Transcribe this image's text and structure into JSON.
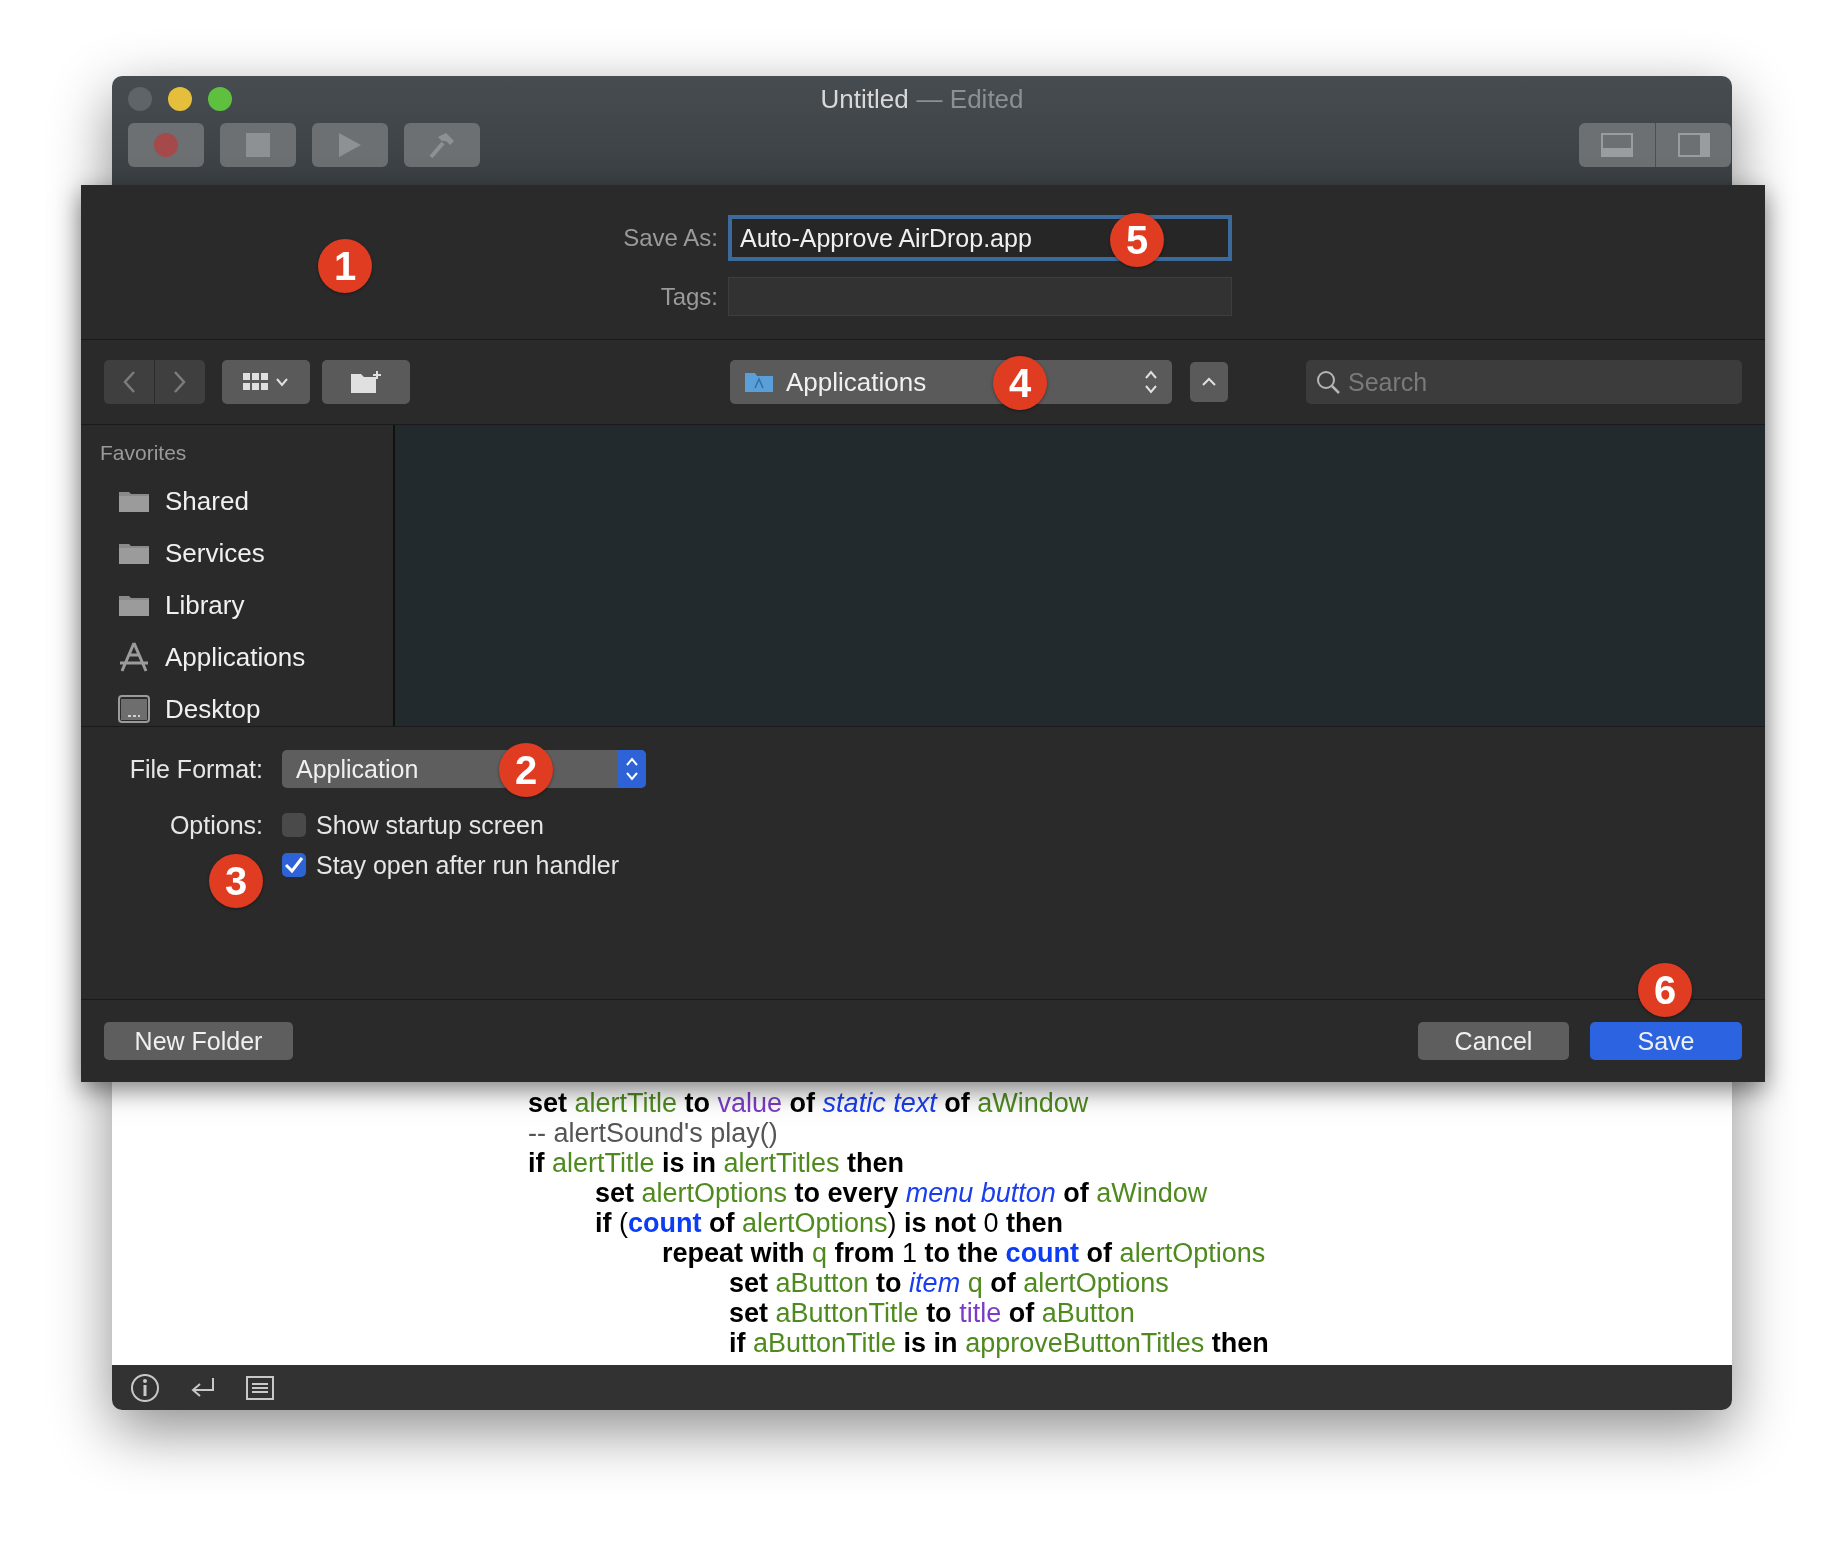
{
  "window": {
    "title": "Untitled",
    "subtitle": "— Edited"
  },
  "save_dialog": {
    "callout": "1",
    "save_as": {
      "label": "Save As:",
      "value": "Auto-Approve AirDrop.app",
      "focused": true,
      "callout": "5"
    },
    "tags": {
      "label": "Tags:"
    },
    "location": {
      "value": "Applications",
      "callout": "4"
    },
    "search": {
      "placeholder": "Search"
    },
    "sidebar": {
      "heading": "Favorites",
      "items": [
        {
          "label": "Shared",
          "kind": "folder"
        },
        {
          "label": "Services",
          "kind": "folder"
        },
        {
          "label": "Library",
          "kind": "folder"
        },
        {
          "label": "Applications",
          "kind": "apps"
        },
        {
          "label": "Desktop",
          "kind": "desktop"
        }
      ]
    },
    "file_format": {
      "label": "File Format:",
      "value": "Application",
      "callout": "2"
    },
    "options": {
      "label": "Options:",
      "callout": "3",
      "items": [
        {
          "label": "Show startup screen",
          "checked": false
        },
        {
          "label": "Stay open after run handler",
          "checked": true
        }
      ]
    },
    "buttons": [
      {
        "label": "New Folder",
        "kind": "plain"
      },
      {
        "label": "Cancel",
        "kind": "plain"
      },
      {
        "label": "Save",
        "kind": "default",
        "callout": "6"
      }
    ]
  },
  "code": [
    {
      "tokens": [
        {
          "kind": "kw",
          "text": "set "
        },
        {
          "kind": "var",
          "text": "alertTitle"
        },
        {
          "kind": "kw",
          "text": " to "
        },
        {
          "kind": "prop",
          "text": "value"
        },
        {
          "kind": "kw",
          "text": " of "
        },
        {
          "kind": "cls",
          "text": "static text"
        },
        {
          "kind": "kw",
          "text": " of "
        },
        {
          "kind": "var",
          "text": "aWindow"
        }
      ]
    },
    {
      "tokens": [
        {
          "kind": "comment",
          "text": "-- alertSound's play()"
        }
      ]
    },
    {
      "tokens": [
        {
          "kind": "kw",
          "text": "if "
        },
        {
          "kind": "var",
          "text": "alertTitle"
        },
        {
          "kind": "kw",
          "text": " is in "
        },
        {
          "kind": "var",
          "text": "alertTitles"
        },
        {
          "kind": "kw",
          "text": " then"
        }
      ],
      "children": [
        {
          "tokens": [
            {
              "kind": "kw",
              "text": "set "
            },
            {
              "kind": "var",
              "text": "alertOptions"
            },
            {
              "kind": "kw",
              "text": " to every "
            },
            {
              "kind": "cls",
              "text": "menu button"
            },
            {
              "kind": "kw",
              "text": " of "
            },
            {
              "kind": "var",
              "text": "aWindow"
            }
          ]
        },
        {
          "tokens": [
            {
              "kind": "kw",
              "text": "if "
            },
            {
              "kind": "plain",
              "text": "("
            },
            {
              "kind": "cmd",
              "text": "count"
            },
            {
              "kind": "kw",
              "text": " of "
            },
            {
              "kind": "var",
              "text": "alertOptions"
            },
            {
              "kind": "plain",
              "text": ")"
            },
            {
              "kind": "kw",
              "text": " is not "
            },
            {
              "kind": "plain",
              "text": "0"
            },
            {
              "kind": "kw",
              "text": " then"
            }
          ],
          "children": [
            {
              "tokens": [
                {
                  "kind": "kw",
                  "text": "repeat with "
                },
                {
                  "kind": "var",
                  "text": "q"
                },
                {
                  "kind": "kw",
                  "text": " from "
                },
                {
                  "kind": "plain",
                  "text": "1"
                },
                {
                  "kind": "kw",
                  "text": " to the "
                },
                {
                  "kind": "cmd",
                  "text": "count"
                },
                {
                  "kind": "kw",
                  "text": " of "
                },
                {
                  "kind": "var",
                  "text": "alertOptions"
                }
              ],
              "children": [
                {
                  "tokens": [
                    {
                      "kind": "kw",
                      "text": "set "
                    },
                    {
                      "kind": "var",
                      "text": "aButton"
                    },
                    {
                      "kind": "kw",
                      "text": " to "
                    },
                    {
                      "kind": "cls",
                      "text": "item"
                    },
                    {
                      "kind": "var",
                      "text": " q"
                    },
                    {
                      "kind": "kw",
                      "text": " of "
                    },
                    {
                      "kind": "var",
                      "text": "alertOptions"
                    }
                  ]
                },
                {
                  "tokens": [
                    {
                      "kind": "kw",
                      "text": "set "
                    },
                    {
                      "kind": "var",
                      "text": "aButtonTitle"
                    },
                    {
                      "kind": "kw",
                      "text": " to "
                    },
                    {
                      "kind": "prop",
                      "text": "title"
                    },
                    {
                      "kind": "kw",
                      "text": " of "
                    },
                    {
                      "kind": "var",
                      "text": "aButton"
                    }
                  ]
                },
                {
                  "tokens": [
                    {
                      "kind": "kw",
                      "text": "if "
                    },
                    {
                      "kind": "var",
                      "text": "aButtonTitle"
                    },
                    {
                      "kind": "kw",
                      "text": " is in "
                    },
                    {
                      "kind": "var",
                      "text": "approveButtonTitles"
                    },
                    {
                      "kind": "kw",
                      "text": " then"
                    }
                  ]
                }
              ]
            }
          ]
        }
      ]
    }
  ]
}
